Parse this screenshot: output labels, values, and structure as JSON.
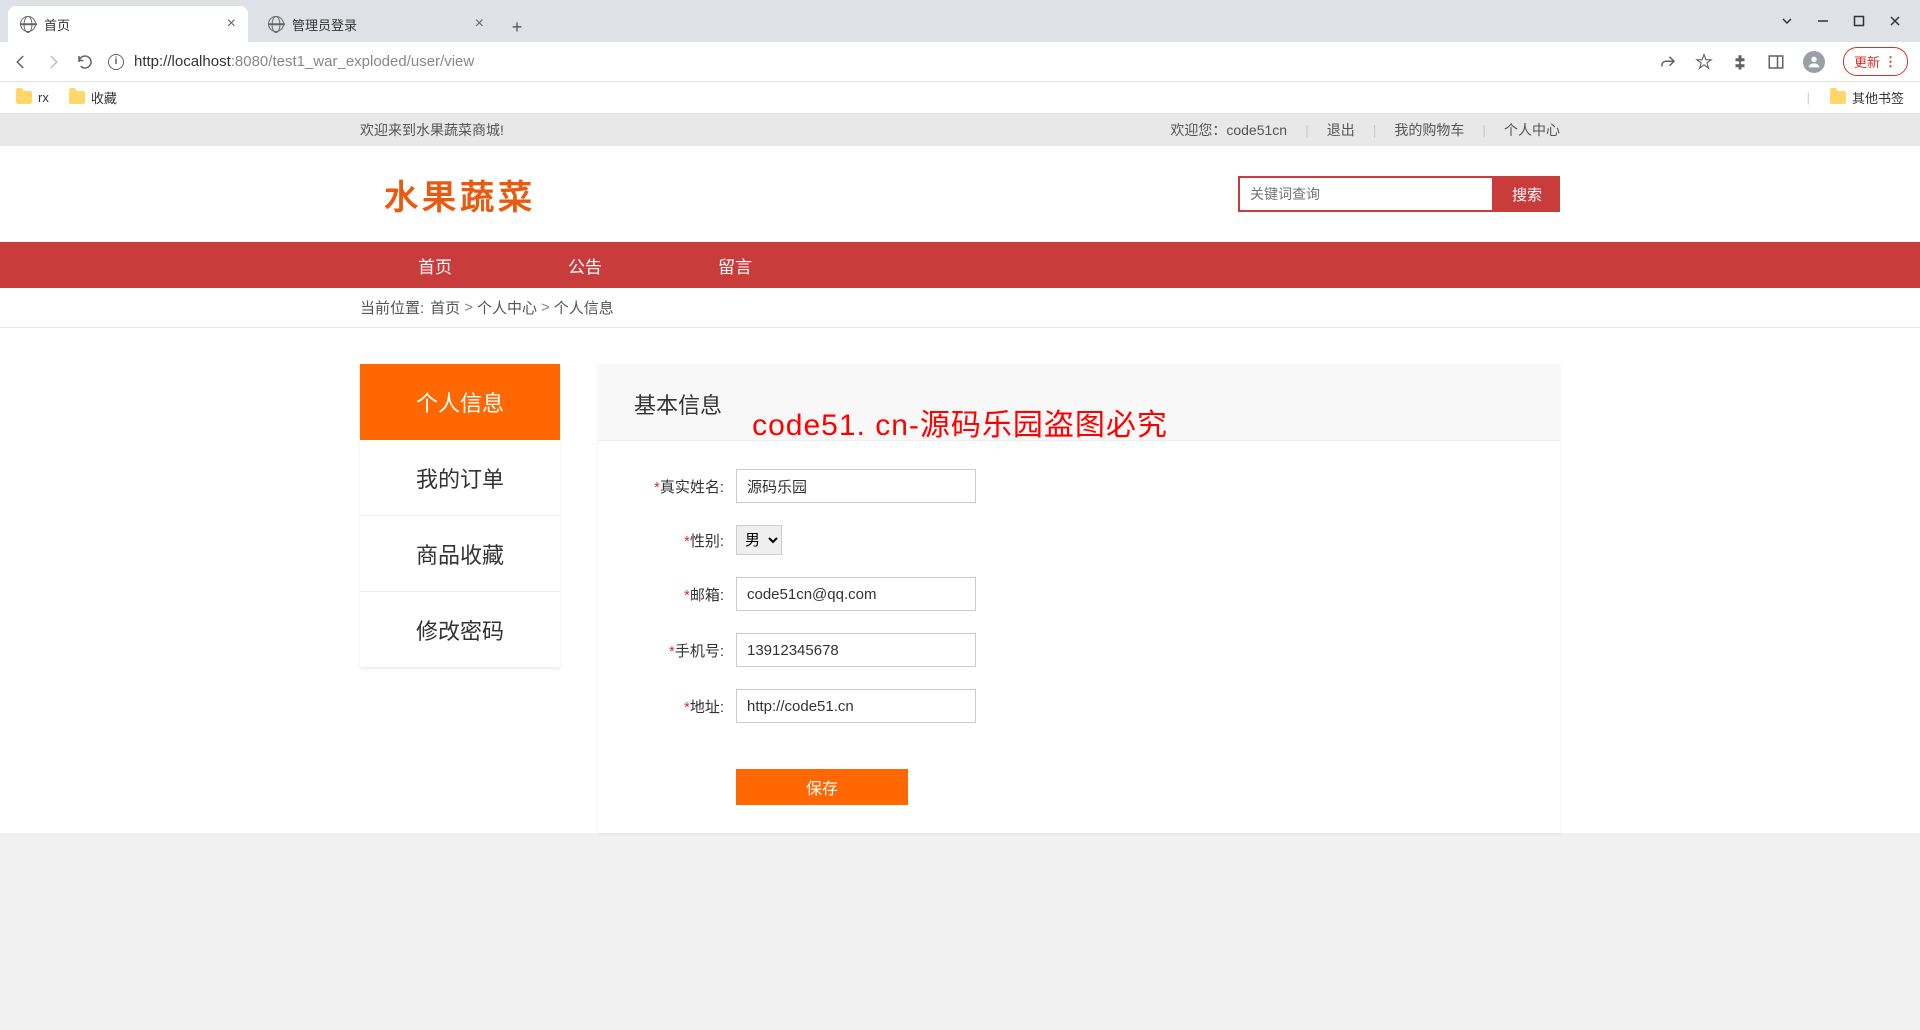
{
  "browser": {
    "tabs": [
      {
        "title": "首页"
      },
      {
        "title": "管理员登录"
      }
    ],
    "url_host": "localhost",
    "url_port": ":8080",
    "url_path": "/test1_war_exploded/user/view",
    "update_label": "更新",
    "bookmarks": [
      {
        "label": "rx"
      },
      {
        "label": "收藏"
      }
    ],
    "other_bookmarks": "其他书签"
  },
  "topbar": {
    "welcome": "欢迎来到水果蔬菜商城!",
    "greet_prefix": "欢迎您：",
    "username": "code51cn",
    "logout": "退出",
    "cart": "我的购物车",
    "profile": "个人中心"
  },
  "header": {
    "logo": "水果蔬菜",
    "search_placeholder": "关键词查询",
    "search_btn": "搜索"
  },
  "nav": {
    "items": [
      "首页",
      "公告",
      "留言"
    ]
  },
  "crumb": {
    "label": "当前位置:",
    "items": [
      "首页",
      "个人中心",
      "个人信息"
    ]
  },
  "sidebar": {
    "items": [
      "个人信息",
      "我的订单",
      "商品收藏",
      "修改密码"
    ]
  },
  "main": {
    "title": "基本信息",
    "fields": {
      "name_label": "真实姓名:",
      "name_value": "源码乐园",
      "gender_label": "性别:",
      "gender_value": "男",
      "email_label": "邮箱:",
      "email_value": "code51cn@qq.com",
      "phone_label": "手机号:",
      "phone_value": "13912345678",
      "address_label": "地址:",
      "address_value": "http://code51.cn"
    },
    "save": "保存"
  },
  "watermark": "code51. cn-源码乐园盗图必究"
}
